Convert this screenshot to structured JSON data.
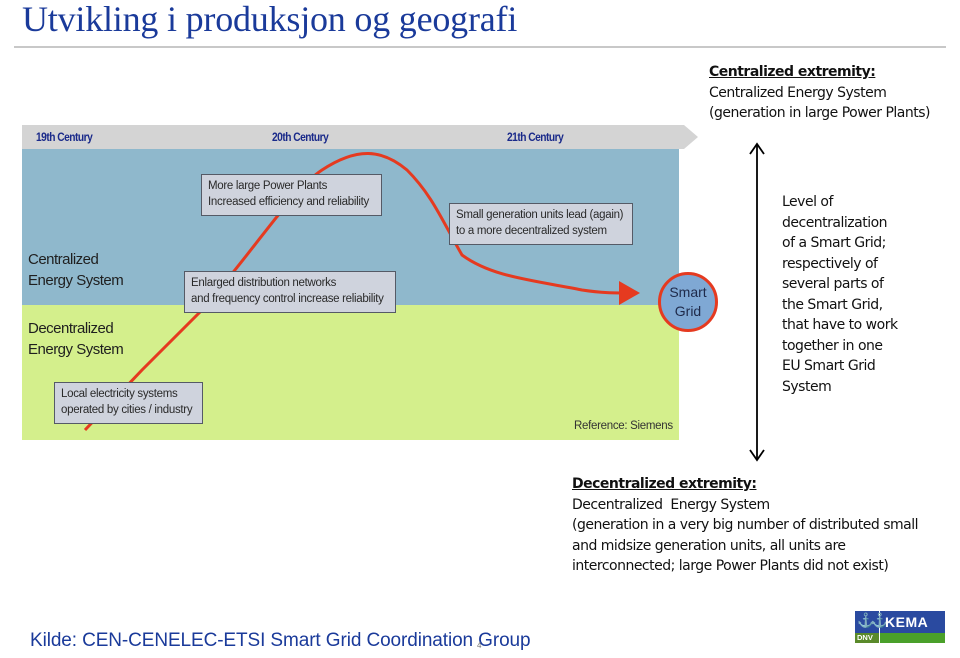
{
  "slide": {
    "title": "Utvikling i produksjon og geografi",
    "source": "Kilde: CEN-CENELEC-ETSI Smart Grid Coordination Group",
    "page_number": "4"
  },
  "diagram": {
    "timeline": [
      "19th Century",
      "20th Century",
      "21th Century"
    ],
    "bands": {
      "centralized": [
        "Centralized",
        "Energy System"
      ],
      "decentralized": [
        "Decentralized",
        "Energy System"
      ]
    },
    "notes": [
      {
        "lines": [
          "More large Power Plants",
          "Increased efficiency and reliability"
        ]
      },
      {
        "lines": [
          "Enlarged distribution networks",
          "and frequency control increase reliability"
        ]
      },
      {
        "lines": [
          "Small generation units lead (again)",
          "to a more decentralized system"
        ]
      },
      {
        "lines": [
          "Local electricity systems",
          "operated by cities / industry"
        ]
      }
    ],
    "smart_grid": [
      "Smart",
      "Grid"
    ],
    "reference": "Reference: Siemens",
    "colors": {
      "centralized_band": "#8fb8cc",
      "decentralized_band": "#d4ef8c",
      "curve": "#e53a20",
      "timeline": "#d4d4d4"
    }
  },
  "right_panel": {
    "centralized_extremity": {
      "heading": "Centralized extremity:",
      "lines": [
        "Centralized Energy System",
        "(generation in large Power Plants)"
      ]
    },
    "axis_label": [
      "Level of",
      "decentralization",
      "of a Smart Grid;",
      "respectively of",
      "several parts of",
      "the Smart Grid,",
      "that have to work",
      "together in one",
      "EU Smart Grid",
      "System"
    ],
    "decentralized_extremity": {
      "heading": "Decentralized extremity:",
      "lines": [
        "Decentralized  Energy System",
        "(generation in a very big number of distributed small",
        "and midsize generation units, all units are",
        "interconnected; large Power Plants did not exist)"
      ]
    }
  },
  "logo": {
    "brand": "KEMA",
    "sub": "DNV"
  }
}
